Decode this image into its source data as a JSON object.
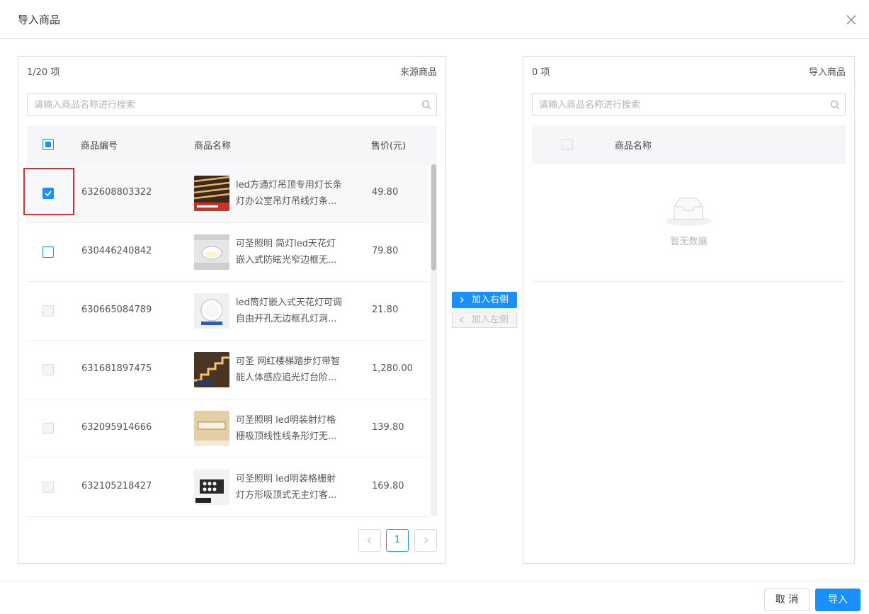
{
  "dialog": {
    "title": "导入商品",
    "cancel_label": "取 消",
    "ok_label": "导入"
  },
  "source": {
    "count_label": "1/20 项",
    "title": "来源商品",
    "search_placeholder": "请输入商品名称进行搜索",
    "columns": {
      "code": "商品编号",
      "name": "商品名称",
      "price": "售价(元)"
    },
    "rows": [
      {
        "code": "632608803322",
        "name_line1": "led方通灯吊顶专用灯长条",
        "name_line2": "灯办公室吊灯吊线灯条...",
        "price": "49.80",
        "checked": true
      },
      {
        "code": "630446240842",
        "name_line1": "可圣照明 简灯led天花灯",
        "name_line2": "嵌入式防眩光窄边框无...",
        "price": "79.80",
        "checked": false
      },
      {
        "code": "630665084789",
        "name_line1": "led筒灯嵌入式天花灯可调",
        "name_line2": "自由开孔无边框孔灯洞...",
        "price": "21.80",
        "checked": false
      },
      {
        "code": "631681897475",
        "name_line1": "可圣 网红楼梯踏步灯带智",
        "name_line2": "能人体感应追光灯台阶...",
        "price": "1,280.00",
        "checked": false
      },
      {
        "code": "632095914666",
        "name_line1": "可圣照明 led明装射灯格",
        "name_line2": "栅吸顶线性线条形灯无...",
        "price": "139.80",
        "checked": false
      },
      {
        "code": "632105218427",
        "name_line1": "可圣照明 led明装格栅射",
        "name_line2": "灯方形吸顶式无主灯客...",
        "price": "169.80",
        "checked": false
      }
    ],
    "pagination": {
      "current_page": "1"
    }
  },
  "transfer": {
    "to_right_label": "加入右侧",
    "to_left_label": "加入左侧"
  },
  "target": {
    "count_label": "0 项",
    "title": "导入商品",
    "search_placeholder": "请输入商品名称进行搜索",
    "columns": {
      "name": "商品名称"
    },
    "empty_text": "暂无数据"
  },
  "colors": {
    "accent": "#1890ff",
    "highlight": "#e02b2b"
  }
}
